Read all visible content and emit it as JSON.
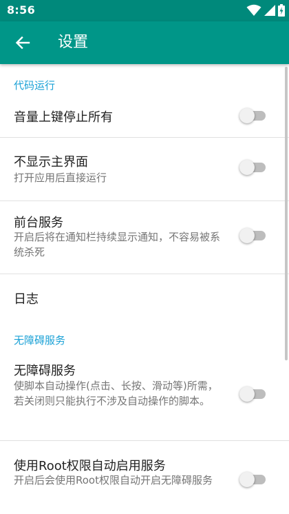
{
  "status_bar": {
    "time": "8:56",
    "icons": [
      "wifi-icon",
      "cellular-signal-icon",
      "battery-charging-icon"
    ]
  },
  "app_bar": {
    "title": "设置",
    "back_icon": "arrow-left-icon",
    "color": "#009688",
    "status_color": "#00897b"
  },
  "categories": {
    "code_run": "代码运行",
    "accessibility": "无障碍服务"
  },
  "prefs": {
    "volume_up_stop": {
      "title": "音量上键停止所有",
      "enabled": false
    },
    "hide_main_ui": {
      "title": "不显示主界面",
      "summary": "打开应用后直接运行",
      "enabled": false
    },
    "foreground_service": {
      "title": "前台服务",
      "summary": "开启后将在通知栏持续显示通知，不容易被系统杀死",
      "enabled": false
    },
    "log": {
      "title": "日志"
    },
    "accessibility_service": {
      "title": "无障碍服务",
      "summary": "使脚本自动操作(点击、长按、滑动等)所需，若关闭则只能执行不涉及自动操作的脚本。",
      "enabled": false
    },
    "root_auto_enable": {
      "title": "使用Root权限自动启用服务",
      "summary": "开启后会使用Root权限自动开启无障碍服务",
      "enabled": false
    }
  },
  "accent_color": "#1aa1d6"
}
